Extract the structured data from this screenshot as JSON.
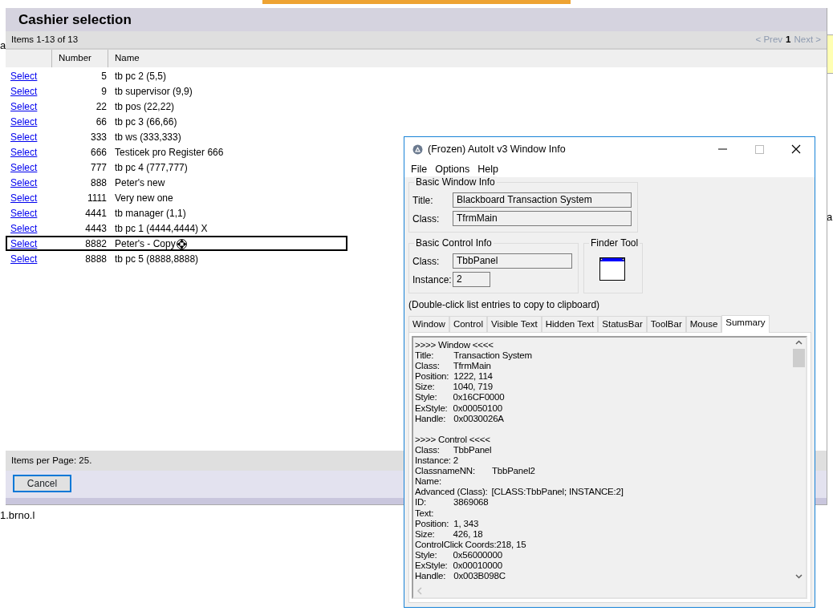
{
  "background": {
    "fragments": [
      "a",
      "1.brno.l",
      "a"
    ]
  },
  "cashier_dialog": {
    "title": "Cashier selection",
    "items_summary": "Items 1-13 of 13",
    "pager": [
      {
        "label": "< Prev",
        "kind": "link",
        "disabled": true
      },
      {
        "label": "1",
        "kind": "current",
        "disabled": false
      },
      {
        "label": "Next >",
        "kind": "link",
        "disabled": true
      }
    ],
    "columns": [
      "Number",
      "Name"
    ],
    "rows": [
      {
        "action": "Select",
        "number": "5",
        "name": "tb pc 2 (5,5)",
        "selected": false
      },
      {
        "action": "Select",
        "number": "9",
        "name": "tb supervisor (9,9)",
        "selected": false
      },
      {
        "action": "Select",
        "number": "22",
        "name": "tb pos (22,22)",
        "selected": false
      },
      {
        "action": "Select",
        "number": "66",
        "name": "tb pc 3 (66,66)",
        "selected": false
      },
      {
        "action": "Select",
        "number": "333",
        "name": "tb ws (333,333)",
        "selected": false
      },
      {
        "action": "Select",
        "number": "666",
        "name": "Testicek pro Register 666",
        "selected": false
      },
      {
        "action": "Select",
        "number": "777",
        "name": "tb pc 4 (777,777)",
        "selected": false
      },
      {
        "action": "Select",
        "number": "888",
        "name": "Peter's new",
        "selected": false
      },
      {
        "action": "Select",
        "number": "1111",
        "name": "Very new one",
        "selected": false
      },
      {
        "action": "Select",
        "number": "4441",
        "name": "tb manager (1,1)",
        "selected": false
      },
      {
        "action": "Select",
        "number": "4443",
        "name": "tb pc 1 (4444,4444) X",
        "selected": false
      },
      {
        "action": "Select",
        "number": "8882",
        "name": "Peter's - Copy",
        "selected": true
      },
      {
        "action": "Select",
        "number": "8888",
        "name": "tb pc 5 (8888,8888)",
        "selected": false
      }
    ],
    "items_per_page": "Items per Page: 25.",
    "cancel_button": "Cancel"
  },
  "autoit_window": {
    "title": "(Frozen) AutoIt v3 Window Info",
    "menu": [
      "File",
      "Options",
      "Help"
    ],
    "basic_window_info": {
      "legend": "Basic Window Info",
      "fields": [
        {
          "label": "Title:",
          "value": "Blackboard Transaction System"
        },
        {
          "label": "Class:",
          "value": "TfrmMain"
        }
      ]
    },
    "basic_control_info": {
      "legend": "Basic Control Info",
      "fields": [
        {
          "label": "Class:",
          "value": "TbbPanel"
        },
        {
          "label": "Instance:",
          "value": "2"
        }
      ]
    },
    "finder_tool": {
      "legend": "Finder Tool"
    },
    "hint": "(Double-click list entries to copy to clipboard)",
    "tabs": [
      {
        "label": "Window",
        "selected": false
      },
      {
        "label": "Control",
        "selected": false
      },
      {
        "label": "Visible Text",
        "selected": false
      },
      {
        "label": "Hidden Text",
        "selected": false
      },
      {
        "label": "StatusBar",
        "selected": false
      },
      {
        "label": "ToolBar",
        "selected": false
      },
      {
        "label": "Mouse",
        "selected": false
      },
      {
        "label": "Summary",
        "selected": true
      }
    ],
    "summary": [
      {
        "heading": ">>>> Window <<<<",
        "lines": [
          {
            "label": "Title:",
            "value": "Transaction System"
          },
          {
            "label": "Class:",
            "value": "TfrmMain"
          },
          {
            "label": "Position:",
            "value": "1222, 114"
          },
          {
            "label": "Size:",
            "value": "1040, 719"
          },
          {
            "label": "Style:",
            "value": "0x16CF0000"
          },
          {
            "label": "ExStyle:",
            "value": "0x00050100"
          },
          {
            "label": "Handle:",
            "value": "0x0030026A"
          }
        ]
      },
      {
        "heading": ">>>> Control <<<<",
        "lines": [
          {
            "label": "Class:",
            "value": "TbbPanel"
          },
          {
            "label": "Instance: 2"
          },
          {
            "label": "ClassnameNN:",
            "value": "TbbPanel2"
          },
          {
            "label": "Name:"
          },
          {
            "label": "Advanced (Class):",
            "value": "[CLASS:TbbPanel; INSTANCE:2]"
          },
          {
            "label": "ID:",
            "value": "3869068"
          },
          {
            "label": "Text:"
          },
          {
            "label": "Position:",
            "value": "1, 343"
          },
          {
            "label": "Size:",
            "value": "426, 18"
          },
          {
            "label": "ControlClick Coords:218, 15"
          },
          {
            "label": "Style:",
            "value": "0x56000000"
          },
          {
            "label": "ExStyle:",
            "value": "0x00010000"
          },
          {
            "label": "Handle:",
            "value": "0x003B098C"
          }
        ]
      }
    ]
  }
}
